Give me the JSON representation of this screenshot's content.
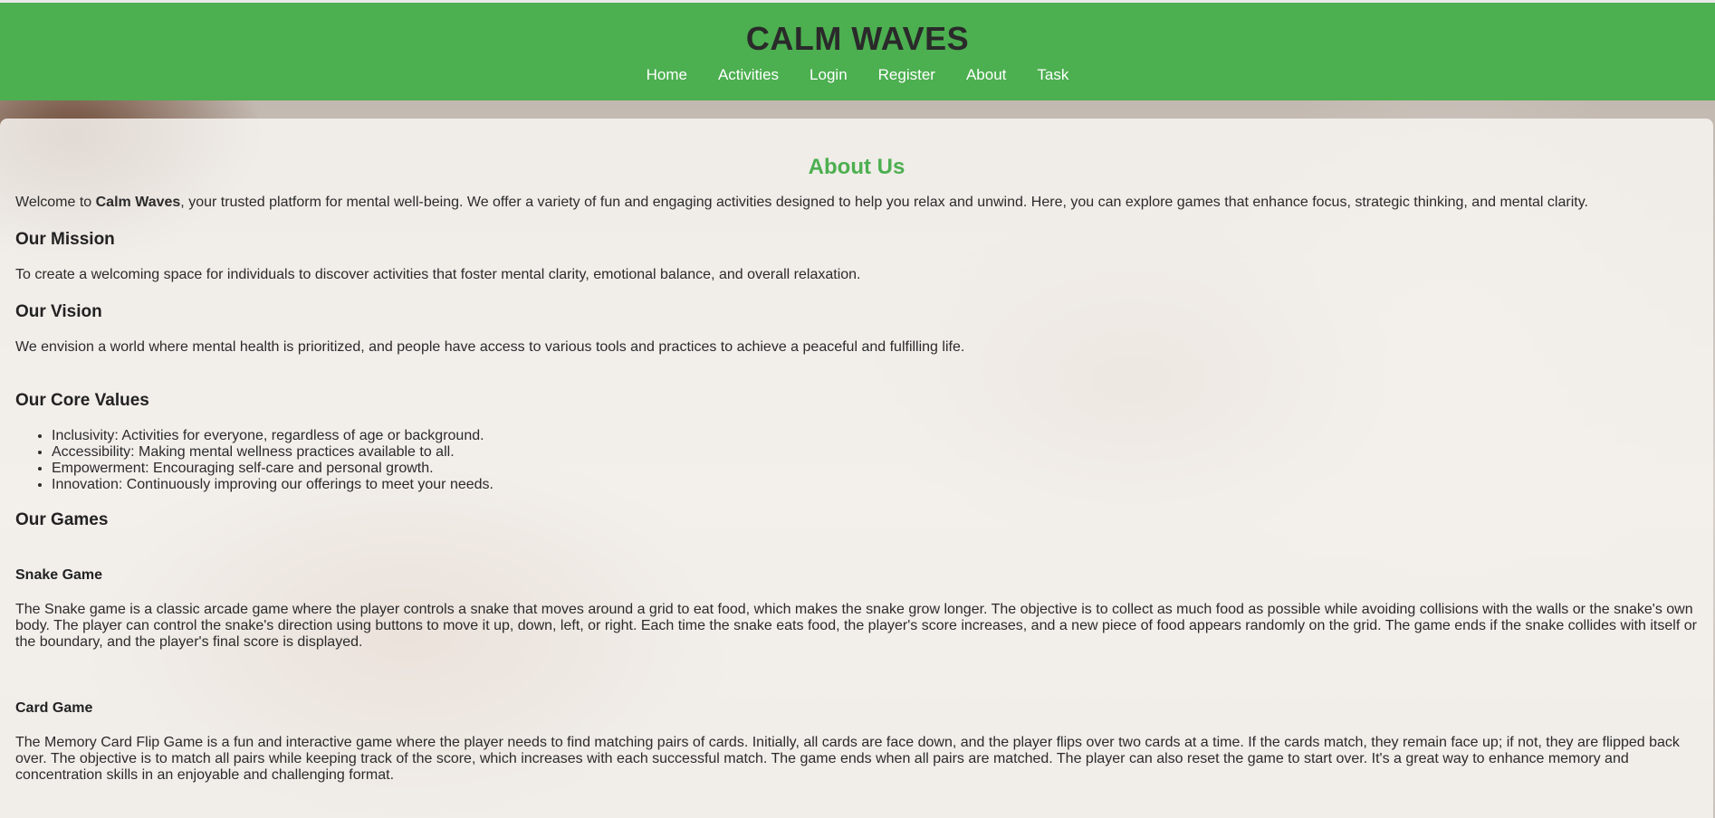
{
  "header": {
    "title": "CALM WAVES",
    "nav": [
      "Home",
      "Activities",
      "Login",
      "Register",
      "About",
      "Task"
    ]
  },
  "about": {
    "title": "About Us",
    "intro_prefix": "Welcome to ",
    "intro_brand": "Calm Waves",
    "intro_suffix": ", your trusted platform for mental well-being. We offer a variety of fun and engaging activities designed to help you relax and unwind. Here, you can explore games that enhance focus, strategic thinking, and mental clarity.",
    "mission_heading": "Our Mission",
    "mission_text": "To create a welcoming space for individuals to discover activities that foster mental clarity, emotional balance, and overall relaxation.",
    "vision_heading": "Our Vision",
    "vision_text": "We envision a world where mental health is prioritized, and people have access to various tools and practices to achieve a peaceful and fulfilling life.",
    "values_heading": "Our Core Values",
    "values": [
      "Inclusivity: Activities for everyone, regardless of age or background.",
      "Accessibility: Making mental wellness practices available to all.",
      "Empowerment: Encouraging self-care and personal growth.",
      "Innovation: Continuously improving our offerings to meet your needs."
    ],
    "games_heading": "Our Games",
    "snake_heading": "Snake Game",
    "snake_text": "The Snake game is a classic arcade game where the player controls a snake that moves around a grid to eat food, which makes the snake grow longer. The objective is to collect as much food as possible while avoiding collisions with the walls or the snake's own body. The player can control the snake's direction using buttons to move it up, down, left, or right. Each time the snake eats food, the player's score increases, and a new piece of food appears randomly on the grid. The game ends if the snake collides with itself or the boundary, and the player's final score is displayed.",
    "card_heading": "Card Game",
    "card_text": "The Memory Card Flip Game is a fun and interactive game where the player needs to find matching pairs of cards. Initially, all cards are face down, and the player flips over two cards at a time. If the cards match, they remain face up; if not, they are flipped back over. The objective is to match all pairs while keeping track of the score, which increases with each successful match. The game ends when all pairs are matched. The player can also reset the game to start over. It's a great way to enhance memory and concentration skills in an enjoyable and challenging format."
  },
  "colors": {
    "header_bg": "#4caf50",
    "accent": "#4caf50",
    "text": "#2b2b2b"
  }
}
